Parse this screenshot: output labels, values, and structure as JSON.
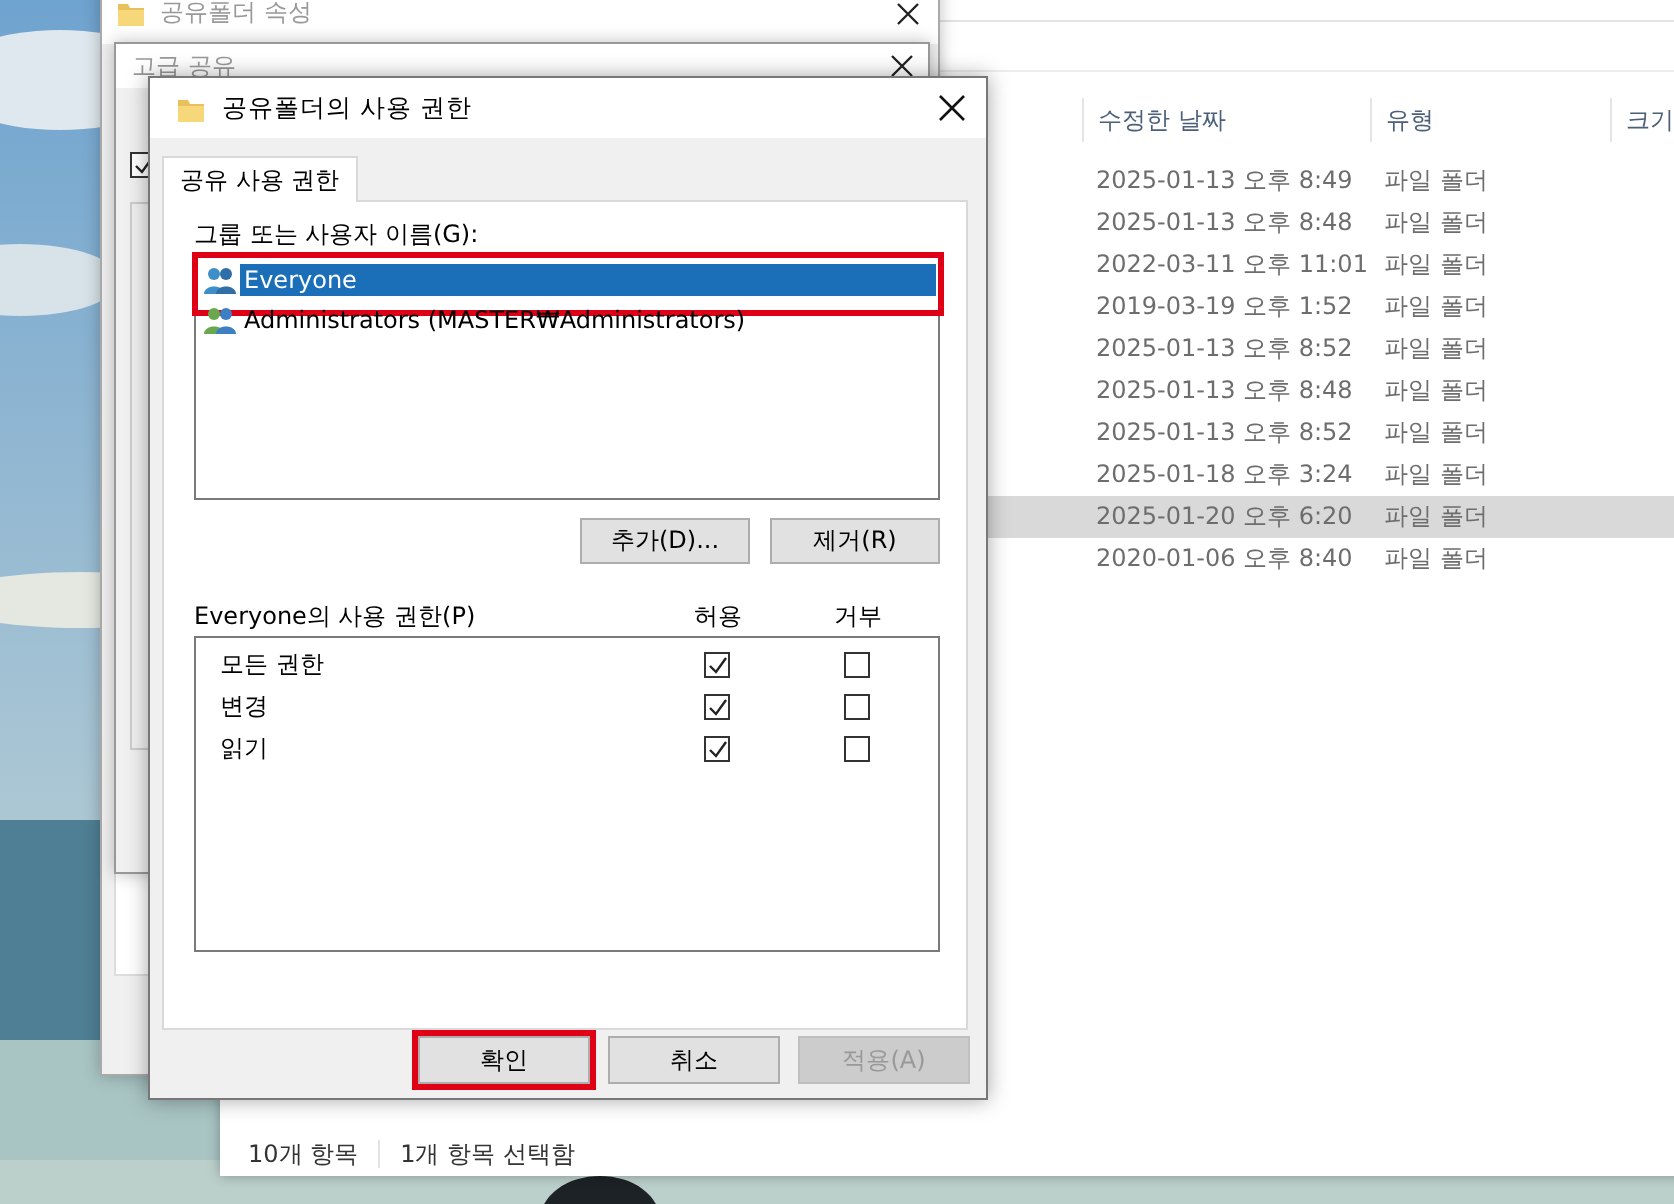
{
  "explorer": {
    "columns": [
      "수정한 날짜",
      "유형",
      "크기"
    ],
    "rows": [
      {
        "modified": "2025-01-13 오후 8:49",
        "type": "파일 폴더",
        "selected": false
      },
      {
        "modified": "2025-01-13 오후 8:48",
        "type": "파일 폴더",
        "selected": false
      },
      {
        "modified": "2022-03-11 오후 11:01",
        "type": "파일 폴더",
        "selected": false
      },
      {
        "modified": "2019-03-19 오후 1:52",
        "type": "파일 폴더",
        "selected": false
      },
      {
        "modified": "2025-01-13 오후 8:52",
        "type": "파일 폴더",
        "selected": false
      },
      {
        "modified": "2025-01-13 오후 8:48",
        "type": "파일 폴더",
        "selected": false
      },
      {
        "modified": "2025-01-13 오후 8:52",
        "type": "파일 폴더",
        "selected": false
      },
      {
        "modified": "2025-01-18 오후 3:24",
        "type": "파일 폴더",
        "selected": false
      },
      {
        "modified": "2025-01-20 오후 6:20",
        "type": "파일 폴더",
        "selected": true
      },
      {
        "modified": "2020-01-06 오후 8:40",
        "type": "파일 폴더",
        "selected": false
      }
    ],
    "status_bar": {
      "item_count": "10개 항목",
      "selection": "1개 항목 선택함"
    }
  },
  "properties_window": {
    "title": "공유폴더 속성"
  },
  "advanced_sharing_window": {
    "title": "고급 공유",
    "share_checkbox": {
      "checked": true
    }
  },
  "permission_dialog": {
    "title": "공유폴더의 사용 권한",
    "tabs": [
      {
        "label": "공유 사용 권한",
        "selected": true
      }
    ],
    "users_label": "그룹 또는 사용자 이름(G):",
    "users": [
      {
        "name": "Everyone",
        "selected": true,
        "annotated": true
      },
      {
        "name": "Administrators (MASTER₩Administrators)",
        "selected": false,
        "annotated": false
      }
    ],
    "user_buttons": [
      {
        "label": "추가(D)..."
      },
      {
        "label": "제거(R)"
      }
    ],
    "permissions_label": "Everyone의 사용 권한(P)",
    "permission_columns": [
      "허용",
      "거부"
    ],
    "permissions": [
      {
        "name": "모든 권한",
        "allow": true,
        "deny": false
      },
      {
        "name": "변경",
        "allow": true,
        "deny": false
      },
      {
        "name": "읽기",
        "allow": true,
        "deny": false
      }
    ],
    "buttons": [
      {
        "label": "확인",
        "disabled": false,
        "annotated": true
      },
      {
        "label": "취소",
        "disabled": false,
        "annotated": false
      },
      {
        "label": "적용(A)",
        "disabled": true,
        "annotated": false
      }
    ]
  }
}
